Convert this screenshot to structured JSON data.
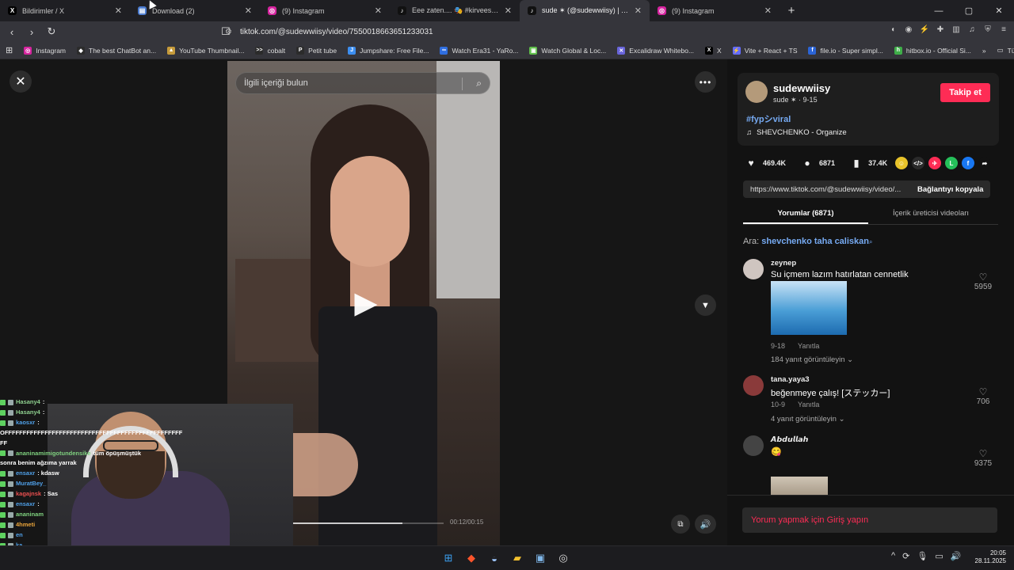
{
  "browser": {
    "tabs": [
      {
        "title": "Bildirimler / X",
        "icon": "x-logo-icon",
        "color": "#000000",
        "glyph": "X"
      },
      {
        "title": "Download (2)",
        "icon": "image-file-icon",
        "color": "#4a7bd0",
        "glyph": "▤"
      },
      {
        "title": "(9) Instagram",
        "icon": "instagram-icon",
        "color": "#d6249f",
        "glyph": "◎"
      },
      {
        "title": "Eee zaten.... 🎭 #kirvees | TikTok",
        "icon": "tiktok-icon",
        "color": "#111111",
        "glyph": "♪"
      },
      {
        "title": "sude ✶ (@sudewwiisy) | TikTok",
        "icon": "tiktok-icon",
        "color": "#111111",
        "glyph": "♪"
      },
      {
        "title": "(9) Instagram",
        "icon": "instagram-icon",
        "color": "#d6249f",
        "glyph": "◎"
      }
    ],
    "new_tab": "+",
    "url": "tiktok.com/@sudewwiisy/video/7550018663651233031",
    "bookmarks": [
      {
        "label": "Instagram",
        "color": "#d6249f",
        "glyph": "◎"
      },
      {
        "label": "The best ChatBot an...",
        "color": "#2b2b2b",
        "glyph": "◆"
      },
      {
        "label": "YouTube Thumbnail...",
        "color": "#c69b3b",
        "glyph": "▲"
      },
      {
        "label": "cobalt",
        "color": "#2b2b2b",
        "glyph": ">>"
      },
      {
        "label": "Petit tube",
        "color": "#2b2b2b",
        "glyph": "P"
      },
      {
        "label": "Jumpshare: Free File...",
        "color": "#3c8ef0",
        "glyph": "J"
      },
      {
        "label": "Watch Era31 - YaRo...",
        "color": "#2f6ee0",
        "glyph": "∞"
      },
      {
        "label": "Watch Global & Loc...",
        "color": "#5fbf4a",
        "glyph": "▣"
      },
      {
        "label": "Excalidraw Whitebo...",
        "color": "#6965db",
        "glyph": "✕"
      },
      {
        "label": "X",
        "color": "#000000",
        "glyph": "X"
      },
      {
        "label": "Vite + React + TS",
        "color": "#646cff",
        "glyph": "⚡"
      },
      {
        "label": "file.io - Super simpl...",
        "color": "#2b64d6",
        "glyph": "f"
      },
      {
        "label": "hitbox.io - Official Si...",
        "color": "#3fae49",
        "glyph": "h"
      }
    ],
    "more_bookmarks": "»",
    "all_bookmarks": "Tüm Yer İşaretleri"
  },
  "video": {
    "search_placeholder": "İlgili içeriği bulun",
    "time": "00:12/00:15",
    "progress_fraction": 0.8
  },
  "stream_chat": [
    {
      "user": "Hasany4",
      "msg": ":",
      "color": "#8ecf8e"
    },
    {
      "user": "Hasany4",
      "msg": ":",
      "color": "#8ecf8e"
    },
    {
      "user": "kaosxr",
      "msg": ":",
      "color": "#4fa0e8"
    },
    {
      "user": "",
      "msg": "OFFFFFFFFFFFFFFFFFFFFFFFFFFFFFFFFFFFFFFFFFFFFFFFFF",
      "color": "#ffffff"
    },
    {
      "user": "",
      "msg": "FF",
      "color": "#ffffff"
    },
    {
      "user": "ananinamimigotundensike",
      "msg": "tüm öpüşmüştük",
      "color": "#7fd17f"
    },
    {
      "user": "",
      "msg": "sonra benim ağzıma yarrak",
      "color": "#ffffff"
    },
    {
      "user": "ensaxr",
      "msg": ": kdasw",
      "color": "#4fa0e8"
    },
    {
      "user": "MuratBey_",
      "msg": "",
      "color": "#4fa0e8"
    },
    {
      "user": "kagajnsk",
      "msg": ": Sas",
      "color": "#e84f4f"
    },
    {
      "user": "ensaxr",
      "msg": ":",
      "color": "#4fa0e8"
    },
    {
      "user": "ananinam",
      "msg": "",
      "color": "#7fd17f"
    },
    {
      "user": "4hmeti",
      "msg": "",
      "color": "#e8a33a"
    },
    {
      "user": "en",
      "msg": "",
      "color": "#4fa0e8"
    },
    {
      "user": "ka",
      "msg": "",
      "color": "#4fa0e8"
    }
  ],
  "post": {
    "username": "sudewwiisy",
    "subline": "sude ✶ · 9-15",
    "follow_label": "Takip et",
    "hashtag": "#fypシviral",
    "music": "SHEVCHENKO - Organize",
    "likes": "469.4K",
    "comments": "6871",
    "saves": "37.4K",
    "share_icons": [
      {
        "icon": "emoji-share-icon",
        "color": "#e8c32a",
        "glyph": "☺"
      },
      {
        "icon": "embed-icon",
        "color": "#2a2a2a",
        "glyph": "</>"
      },
      {
        "icon": "telegram-share-icon",
        "color": "#fe2c55",
        "glyph": "✈"
      },
      {
        "icon": "line-share-icon",
        "color": "#25c05a",
        "glyph": "L"
      },
      {
        "icon": "facebook-share-icon",
        "color": "#1877f2",
        "glyph": "f"
      },
      {
        "icon": "forward-share-icon",
        "color": "#121212",
        "glyph": "➦"
      }
    ],
    "link": "https://www.tiktok.com/@sudewwiisy/video/...",
    "copy_label": "Bağlantıyı kopyala",
    "tab_comments": "Yorumlar (6871)",
    "tab_creator": "İçerik üreticisi videoları",
    "search_prefix": "Ara:",
    "search_term": "shevchenko taha caliskan",
    "comments_list": [
      {
        "name": "zeynep",
        "text": "Su içmem lazım hatırlatan cennetlik",
        "date": "9-18",
        "reply": "Yanıtla",
        "replies": "184 yanıt görüntüleyin",
        "likes": "5959"
      },
      {
        "name": "tana.yaya3",
        "text": "beğenmeye çalış! [ステッカー]",
        "date": "10-9",
        "reply": "Yanıtla",
        "replies": "4 yanıt görüntüleyin",
        "likes": "706"
      },
      {
        "name": "𝘼𝙗𝙙𝙪𝙡𝙡𝙖𝙝",
        "text": "😋",
        "likes": "9375"
      }
    ],
    "login_prompt": "Yorum yapmak için Giriş yapın"
  },
  "taskbar": {
    "time": "20:05",
    "date": "28.11.2025"
  }
}
